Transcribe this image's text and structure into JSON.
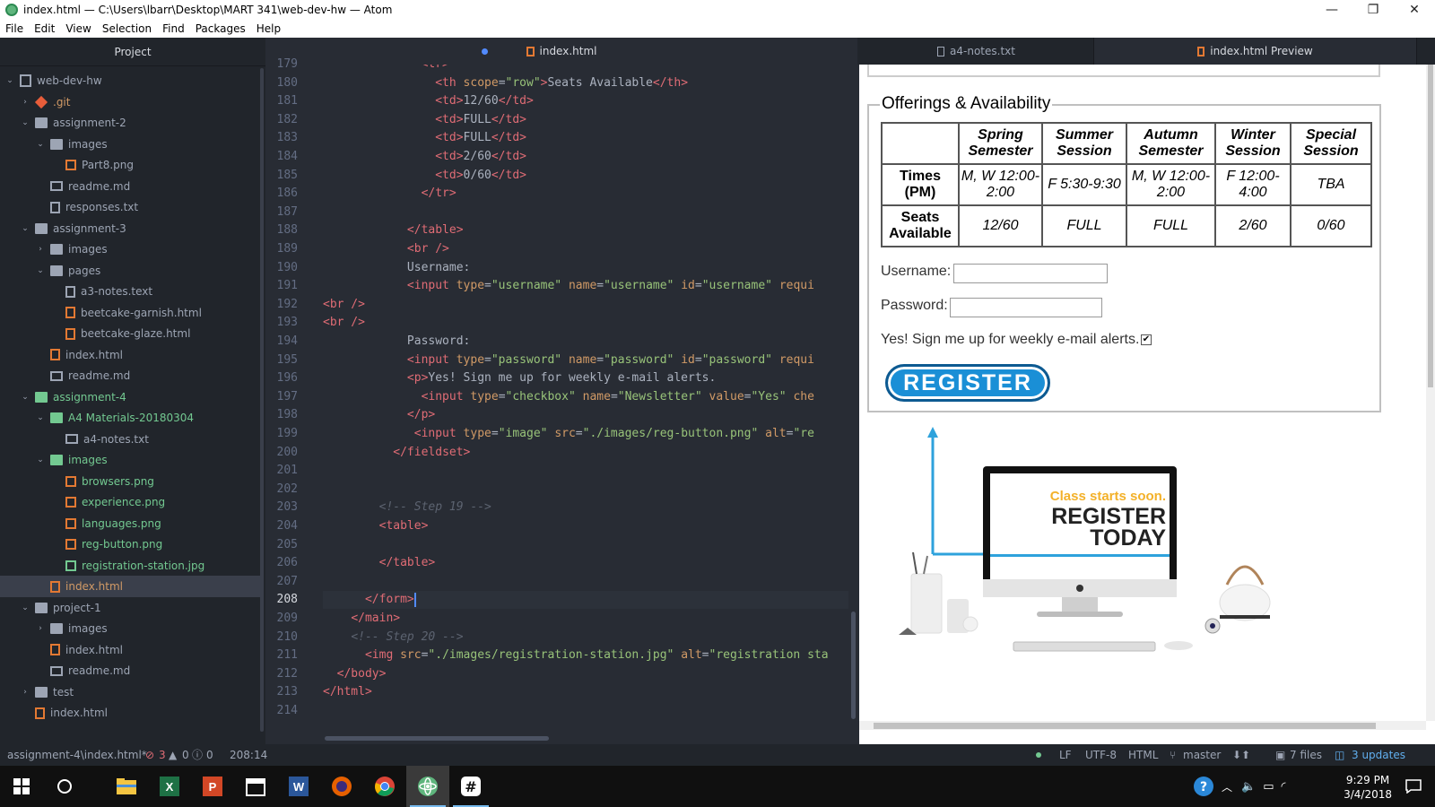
{
  "window": {
    "title": "index.html — C:\\Users\\lbarr\\Desktop\\MART 341\\web-dev-hw — Atom",
    "controls": {
      "minimize": "—",
      "maximize": "❐",
      "close": "✕"
    }
  },
  "menu": [
    "File",
    "Edit",
    "View",
    "Selection",
    "Find",
    "Packages",
    "Help"
  ],
  "tree": {
    "header": "Project",
    "items": [
      {
        "label": "web-dev-hw",
        "depth": 0,
        "caret": "open",
        "icon": "repo"
      },
      {
        "label": ".git",
        "depth": 1,
        "caret": "closed",
        "icon": "git",
        "tone": "orange"
      },
      {
        "label": "assignment-2",
        "depth": 1,
        "caret": "open",
        "icon": "folder"
      },
      {
        "label": "images",
        "depth": 2,
        "caret": "open",
        "icon": "folder"
      },
      {
        "label": "Part8.png",
        "depth": 3,
        "caret": "",
        "icon": "img"
      },
      {
        "label": "readme.md",
        "depth": 2,
        "caret": "",
        "icon": "md"
      },
      {
        "label": "responses.txt",
        "depth": 2,
        "caret": "",
        "icon": "text"
      },
      {
        "label": "assignment-3",
        "depth": 1,
        "caret": "open",
        "icon": "folder"
      },
      {
        "label": "images",
        "depth": 2,
        "caret": "closed",
        "icon": "folder"
      },
      {
        "label": "pages",
        "depth": 2,
        "caret": "open",
        "icon": "folder"
      },
      {
        "label": "a3-notes.text",
        "depth": 3,
        "caret": "",
        "icon": "text"
      },
      {
        "label": "beetcake-garnish.html",
        "depth": 3,
        "caret": "",
        "icon": "html"
      },
      {
        "label": "beetcake-glaze.html",
        "depth": 3,
        "caret": "",
        "icon": "html"
      },
      {
        "label": "index.html",
        "depth": 2,
        "caret": "",
        "icon": "html"
      },
      {
        "label": "readme.md",
        "depth": 2,
        "caret": "",
        "icon": "md"
      },
      {
        "label": "assignment-4",
        "depth": 1,
        "caret": "open",
        "icon": "folder-green",
        "tone": "green"
      },
      {
        "label": "A4 Materials-20180304",
        "depth": 2,
        "caret": "open",
        "icon": "folder-green",
        "tone": "green"
      },
      {
        "label": "a4-notes.txt",
        "depth": 3,
        "caret": "",
        "icon": "md"
      },
      {
        "label": "images",
        "depth": 2,
        "caret": "open",
        "icon": "folder-green",
        "tone": "green"
      },
      {
        "label": "browsers.png",
        "depth": 3,
        "caret": "",
        "icon": "img",
        "tone": "green"
      },
      {
        "label": "experience.png",
        "depth": 3,
        "caret": "",
        "icon": "img",
        "tone": "green"
      },
      {
        "label": "languages.png",
        "depth": 3,
        "caret": "",
        "icon": "img",
        "tone": "green"
      },
      {
        "label": "reg-button.png",
        "depth": 3,
        "caret": "",
        "icon": "img",
        "tone": "green"
      },
      {
        "label": "registration-station.jpg",
        "depth": 3,
        "caret": "",
        "icon": "img-green",
        "tone": "green"
      },
      {
        "label": "index.html",
        "depth": 2,
        "caret": "",
        "icon": "html",
        "tone": "orange",
        "selected": true
      },
      {
        "label": "project-1",
        "depth": 1,
        "caret": "open",
        "icon": "folder"
      },
      {
        "label": "images",
        "depth": 2,
        "caret": "closed",
        "icon": "folder"
      },
      {
        "label": "index.html",
        "depth": 2,
        "caret": "",
        "icon": "html"
      },
      {
        "label": "readme.md",
        "depth": 2,
        "caret": "",
        "icon": "md"
      },
      {
        "label": "test",
        "depth": 1,
        "caret": "closed",
        "icon": "folder"
      },
      {
        "label": "index.html",
        "depth": 1,
        "caret": "",
        "icon": "html"
      }
    ]
  },
  "editor": {
    "tab_label": "index.html",
    "current_line": "208",
    "lines": [
      {
        "n": "179",
        "tokens": [
          [
            "t-txt",
            "              "
          ],
          [
            "t-tag",
            "<tr>"
          ]
        ]
      },
      {
        "n": "180",
        "tokens": [
          [
            "t-txt",
            "                "
          ],
          [
            "t-tag",
            "<th "
          ],
          [
            "t-attr",
            "scope"
          ],
          [
            "t-txt",
            "="
          ],
          [
            "t-str",
            "\"row\""
          ],
          [
            "t-tag",
            ">"
          ],
          [
            "t-txt",
            "Seats Available"
          ],
          [
            "t-tag",
            "</th>"
          ]
        ]
      },
      {
        "n": "181",
        "tokens": [
          [
            "t-txt",
            "                "
          ],
          [
            "t-tag",
            "<td>"
          ],
          [
            "t-txt",
            "12/60"
          ],
          [
            "t-tag",
            "</td>"
          ]
        ]
      },
      {
        "n": "182",
        "tokens": [
          [
            "t-txt",
            "                "
          ],
          [
            "t-tag",
            "<td>"
          ],
          [
            "t-txt",
            "FULL"
          ],
          [
            "t-tag",
            "</td>"
          ]
        ]
      },
      {
        "n": "183",
        "tokens": [
          [
            "t-txt",
            "                "
          ],
          [
            "t-tag",
            "<td>"
          ],
          [
            "t-txt",
            "FULL"
          ],
          [
            "t-tag",
            "</td>"
          ]
        ]
      },
      {
        "n": "184",
        "tokens": [
          [
            "t-txt",
            "                "
          ],
          [
            "t-tag",
            "<td>"
          ],
          [
            "t-txt",
            "2/60"
          ],
          [
            "t-tag",
            "</td>"
          ]
        ]
      },
      {
        "n": "185",
        "tokens": [
          [
            "t-txt",
            "                "
          ],
          [
            "t-tag",
            "<td>"
          ],
          [
            "t-txt",
            "0/60"
          ],
          [
            "t-tag",
            "</td>"
          ]
        ]
      },
      {
        "n": "186",
        "tokens": [
          [
            "t-txt",
            "              "
          ],
          [
            "t-tag",
            "</tr>"
          ]
        ]
      },
      {
        "n": "187",
        "tokens": []
      },
      {
        "n": "188",
        "tokens": [
          [
            "t-txt",
            "            "
          ],
          [
            "t-tag",
            "</table>"
          ]
        ]
      },
      {
        "n": "189",
        "tokens": [
          [
            "t-txt",
            "            "
          ],
          [
            "t-tag",
            "<br />"
          ]
        ]
      },
      {
        "n": "190",
        "tokens": [
          [
            "t-txt",
            "            Username:"
          ]
        ]
      },
      {
        "n": "191",
        "tokens": [
          [
            "t-txt",
            "            "
          ],
          [
            "t-tag",
            "<input "
          ],
          [
            "t-attr",
            "type"
          ],
          [
            "t-txt",
            "="
          ],
          [
            "t-str",
            "\"username\""
          ],
          [
            "t-txt",
            " "
          ],
          [
            "t-attr",
            "name"
          ],
          [
            "t-txt",
            "="
          ],
          [
            "t-str",
            "\"username\""
          ],
          [
            "t-txt",
            " "
          ],
          [
            "t-attr",
            "id"
          ],
          [
            "t-txt",
            "="
          ],
          [
            "t-str",
            "\"username\""
          ],
          [
            "t-txt",
            " "
          ],
          [
            "t-attr",
            "requi"
          ]
        ]
      },
      {
        "n": "192",
        "tokens": [
          [
            "t-tag",
            "<br />"
          ]
        ]
      },
      {
        "n": "193",
        "tokens": [
          [
            "t-tag",
            "<br />"
          ]
        ]
      },
      {
        "n": "194",
        "tokens": [
          [
            "t-txt",
            "            Password:"
          ]
        ]
      },
      {
        "n": "195",
        "tokens": [
          [
            "t-txt",
            "            "
          ],
          [
            "t-tag",
            "<input "
          ],
          [
            "t-attr",
            "type"
          ],
          [
            "t-txt",
            "="
          ],
          [
            "t-str",
            "\"password\""
          ],
          [
            "t-txt",
            " "
          ],
          [
            "t-attr",
            "name"
          ],
          [
            "t-txt",
            "="
          ],
          [
            "t-str",
            "\"password\""
          ],
          [
            "t-txt",
            " "
          ],
          [
            "t-attr",
            "id"
          ],
          [
            "t-txt",
            "="
          ],
          [
            "t-str",
            "\"password\""
          ],
          [
            "t-txt",
            " "
          ],
          [
            "t-attr",
            "requi"
          ]
        ]
      },
      {
        "n": "196",
        "tokens": [
          [
            "t-txt",
            "            "
          ],
          [
            "t-tag",
            "<p>"
          ],
          [
            "t-txt",
            "Yes! Sign me up for weekly e-mail alerts."
          ]
        ]
      },
      {
        "n": "197",
        "tokens": [
          [
            "t-txt",
            "              "
          ],
          [
            "t-tag",
            "<input "
          ],
          [
            "t-attr",
            "type"
          ],
          [
            "t-txt",
            "="
          ],
          [
            "t-str",
            "\"checkbox\""
          ],
          [
            "t-txt",
            " "
          ],
          [
            "t-attr",
            "name"
          ],
          [
            "t-txt",
            "="
          ],
          [
            "t-str",
            "\"Newsletter\""
          ],
          [
            "t-txt",
            " "
          ],
          [
            "t-attr",
            "value"
          ],
          [
            "t-txt",
            "="
          ],
          [
            "t-str",
            "\"Yes\""
          ],
          [
            "t-txt",
            " "
          ],
          [
            "t-attr",
            "che"
          ]
        ]
      },
      {
        "n": "198",
        "tokens": [
          [
            "t-txt",
            "            "
          ],
          [
            "t-tag",
            "</p>"
          ]
        ]
      },
      {
        "n": "199",
        "tokens": [
          [
            "t-txt",
            "             "
          ],
          [
            "t-tag",
            "<input "
          ],
          [
            "t-attr",
            "type"
          ],
          [
            "t-txt",
            "="
          ],
          [
            "t-str",
            "\"image\""
          ],
          [
            "t-txt",
            " "
          ],
          [
            "t-attr",
            "src"
          ],
          [
            "t-txt",
            "="
          ],
          [
            "t-str",
            "\"./images/reg-button.png\""
          ],
          [
            "t-txt",
            " "
          ],
          [
            "t-attr",
            "alt"
          ],
          [
            "t-txt",
            "="
          ],
          [
            "t-str",
            "\"re"
          ]
        ]
      },
      {
        "n": "200",
        "tokens": [
          [
            "t-txt",
            "          "
          ],
          [
            "t-tag",
            "</fieldset>"
          ]
        ]
      },
      {
        "n": "201",
        "tokens": []
      },
      {
        "n": "202",
        "tokens": []
      },
      {
        "n": "203",
        "tokens": [
          [
            "t-txt",
            "        "
          ],
          [
            "t-com",
            "<!-- Step 19 -->"
          ]
        ]
      },
      {
        "n": "204",
        "tokens": [
          [
            "t-txt",
            "        "
          ],
          [
            "t-tag",
            "<table>"
          ]
        ]
      },
      {
        "n": "205",
        "tokens": []
      },
      {
        "n": "206",
        "tokens": [
          [
            "t-txt",
            "        "
          ],
          [
            "t-tag",
            "</table>"
          ]
        ]
      },
      {
        "n": "207",
        "tokens": []
      },
      {
        "n": "208",
        "tokens": [
          [
            "t-txt",
            "      "
          ],
          [
            "t-tag",
            "</form>"
          ]
        ],
        "cursor": true
      },
      {
        "n": "209",
        "tokens": [
          [
            "t-txt",
            "    "
          ],
          [
            "t-tag",
            "</main>"
          ]
        ]
      },
      {
        "n": "210",
        "tokens": [
          [
            "t-txt",
            "    "
          ],
          [
            "t-com",
            "<!-- Step 20 -->"
          ]
        ]
      },
      {
        "n": "211",
        "tokens": [
          [
            "t-txt",
            "      "
          ],
          [
            "t-tag",
            "<img "
          ],
          [
            "t-attr",
            "src"
          ],
          [
            "t-txt",
            "="
          ],
          [
            "t-str",
            "\"./images/registration-station.jpg\""
          ],
          [
            "t-txt",
            " "
          ],
          [
            "t-attr",
            "alt"
          ],
          [
            "t-txt",
            "="
          ],
          [
            "t-str",
            "\"registration sta"
          ]
        ]
      },
      {
        "n": "212",
        "tokens": [
          [
            "t-txt",
            "  "
          ],
          [
            "t-tag",
            "</body>"
          ]
        ]
      },
      {
        "n": "213",
        "tokens": [
          [
            "t-tag",
            "</html>"
          ]
        ]
      },
      {
        "n": "214",
        "tokens": []
      }
    ]
  },
  "preview": {
    "tabs": [
      "a4-notes.txt",
      "index.html Preview"
    ],
    "legend": "Offerings & Availability",
    "table": {
      "headers": [
        "",
        "Spring Semester",
        "Summer Session",
        "Autumn Semester",
        "Winter Session",
        "Special Session"
      ],
      "rows": [
        {
          "head": "Times (PM)",
          "cells": [
            "M, W 12:00-2:00",
            "F 5:30-9:30",
            "M, W 12:00-2:00",
            "F 12:00-4:00",
            "TBA"
          ]
        },
        {
          "head": "Seats Available",
          "cells": [
            "12/60",
            "FULL",
            "FULL",
            "2/60",
            "0/60"
          ]
        }
      ]
    },
    "username_label": "Username:",
    "password_label": "Password:",
    "alerts_label": "Yes! Sign me up for weekly e-mail alerts.",
    "checkbox_mark": "✔",
    "register_button": "REGISTER",
    "ad": {
      "line1": "Class starts soon.",
      "line2": "REGISTER",
      "line3": "TODAY"
    }
  },
  "status": {
    "path": "assignment-4\\index.html*",
    "errors": "3",
    "warnings": "0",
    "infos": "0",
    "position": "208:14",
    "line_ending": "LF",
    "encoding": "UTF-8",
    "grammar": "HTML",
    "branch": "master",
    "files": "7 files",
    "updates": "3 updates"
  },
  "taskbar": {
    "time": "9:29 PM",
    "date": "3/4/2018"
  },
  "colors": {
    "editor_bg": "#282c34",
    "tree_bg": "#21252b",
    "accent": "#528bff",
    "git_added": "#73c991",
    "register_blue": "#1a8fd6"
  }
}
